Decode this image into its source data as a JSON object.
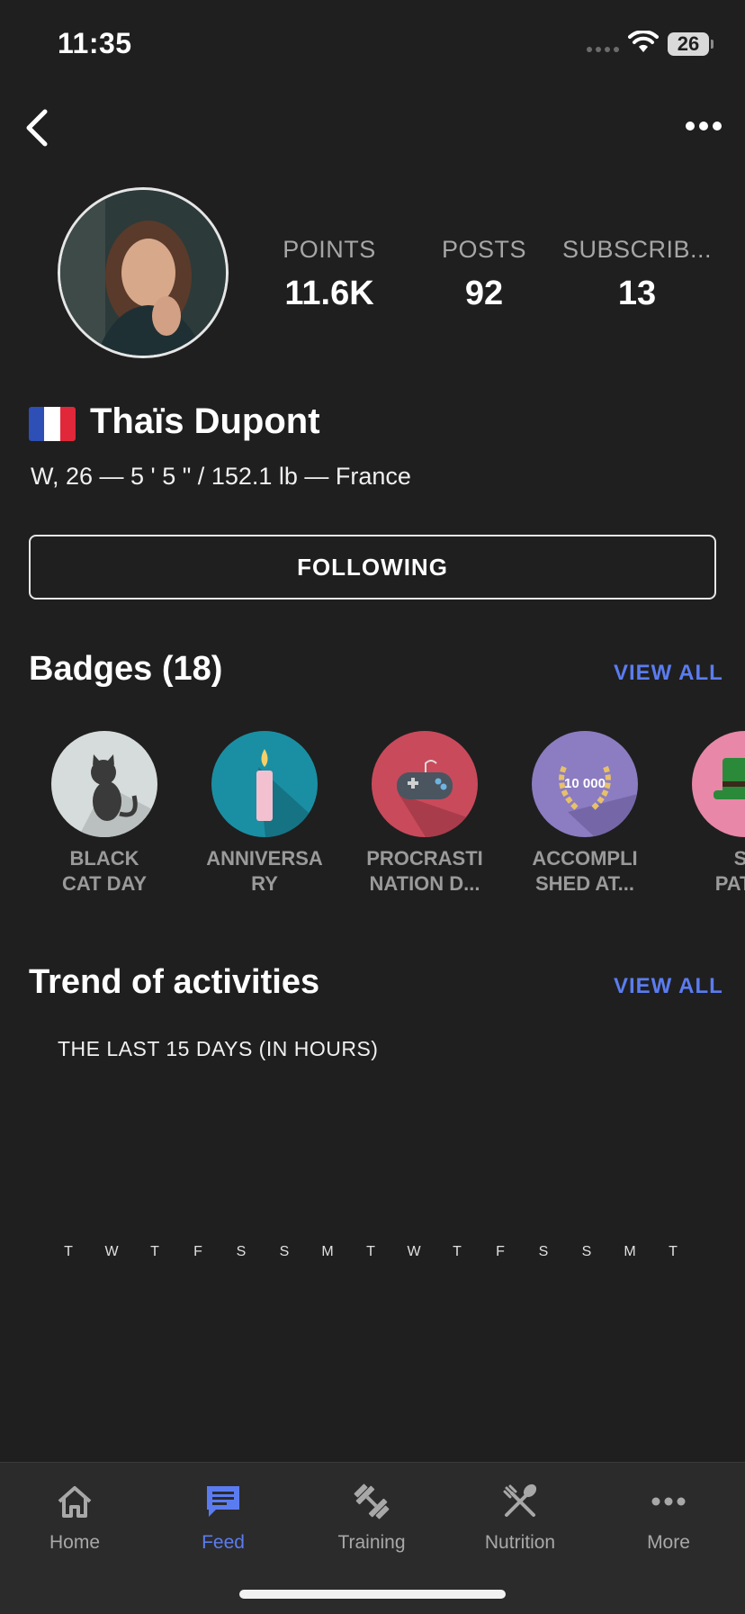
{
  "status": {
    "time": "11:35",
    "battery": "26"
  },
  "profile": {
    "stats": [
      {
        "label": "POINTS",
        "value": "11.6K"
      },
      {
        "label": "POSTS",
        "value": "92"
      },
      {
        "label": "SUBSCRIB...",
        "value": "13"
      }
    ],
    "name": "Thaïs Dupont",
    "meta": "W, 26 —  5 ' 5 \" / 152.1 lb  — France",
    "follow_label": "FOLLOWING"
  },
  "badges": {
    "title": "Badges (18)",
    "view_all": "VIEW ALL",
    "items": [
      {
        "label": "BLACK\nCAT DAY",
        "icon": "black-cat-icon",
        "color": "#d6dcdb"
      },
      {
        "label": "ANNIVERSA\nRY",
        "icon": "candle-icon",
        "color": "#1a8fa3"
      },
      {
        "label": "PROCRASTI\nNATION D...",
        "icon": "gamepad-icon",
        "color": "#c94a5b"
      },
      {
        "label": "ACCOMPLI\nSHED AT...",
        "icon": "laurel-icon",
        "color": "#8c7cc2",
        "text": "10 000"
      },
      {
        "label": "S\nPATR",
        "icon": "leprechaun-hat-icon",
        "color": "#e887a8"
      }
    ]
  },
  "trend": {
    "title": "Trend of activities",
    "view_all": "VIEW ALL",
    "subtitle": "THE LAST 15 DAYS (IN HOURS)",
    "days": [
      "T",
      "W",
      "T",
      "F",
      "S",
      "S",
      "M",
      "T",
      "W",
      "T",
      "F",
      "S",
      "S",
      "M",
      "T"
    ]
  },
  "tabs": [
    {
      "label": "Home",
      "icon": "home-icon",
      "active": false
    },
    {
      "label": "Feed",
      "icon": "feed-icon",
      "active": true
    },
    {
      "label": "Training",
      "icon": "dumbbell-icon",
      "active": false
    },
    {
      "label": "Nutrition",
      "icon": "utensils-icon",
      "active": false
    },
    {
      "label": "More",
      "icon": "more-dots-icon",
      "active": false
    }
  ],
  "colors": {
    "accent": "#5b7cf0",
    "background": "#1f1f1f",
    "tabbar": "#2b2b2b"
  }
}
